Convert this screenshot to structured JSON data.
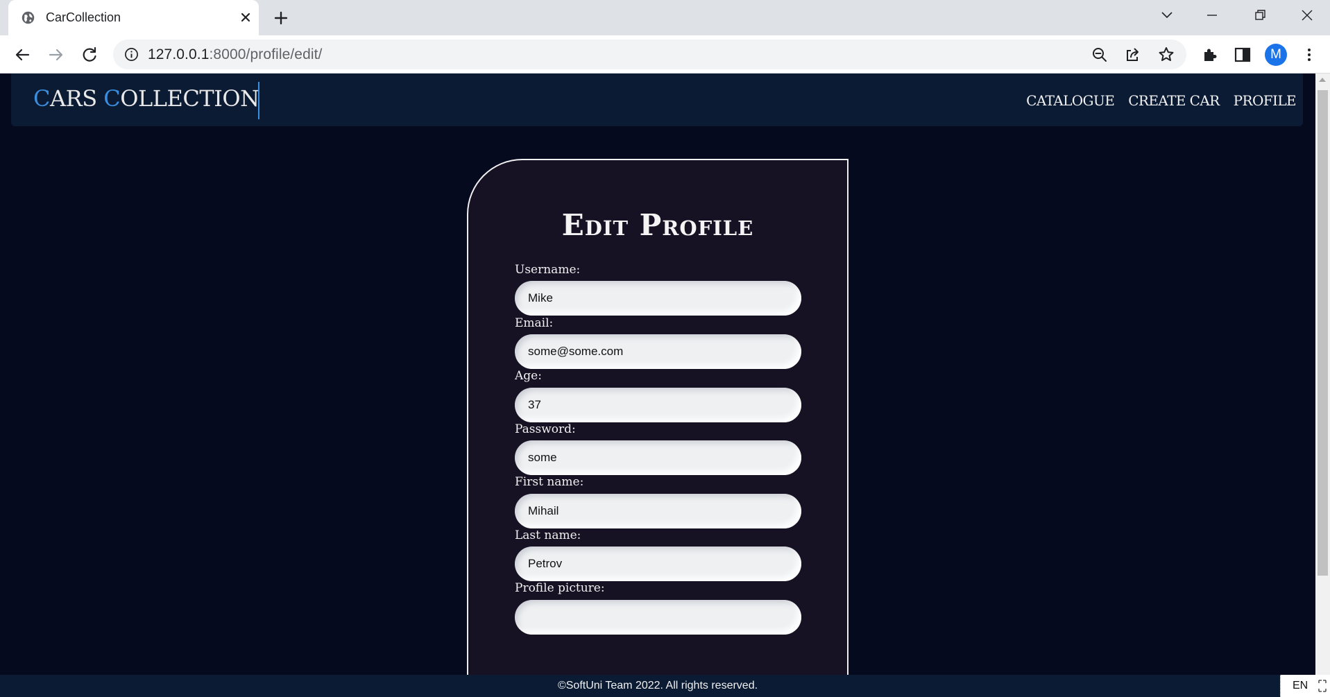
{
  "browser": {
    "tab_title": "CarCollection",
    "url_host": "127.0.0.1",
    "url_rest": ":8000/profile/edit/",
    "profile_initial": "M",
    "icons": [
      "globe-icon",
      "close-icon",
      "plus-icon",
      "chevron-down-icon",
      "minimize-icon",
      "restore-icon",
      "close-window-icon",
      "back-arrow-icon",
      "forward-arrow-icon",
      "reload-icon",
      "info-icon",
      "zoom-out-icon",
      "share-icon",
      "star-icon",
      "extensions-icon",
      "side-panel-icon",
      "more-vert-icon"
    ]
  },
  "site": {
    "logo_c1": "C",
    "logo_w1": "ARS ",
    "logo_c2": "C",
    "logo_w2": "OLLECTION",
    "nav": [
      "CATALOGUE",
      "CREATE CAR",
      "PROFILE"
    ],
    "accent_color": "#3a8fe0",
    "header_bg": "#0c1b34",
    "page_bg": "#050a1f",
    "card_bg": "#171124"
  },
  "form": {
    "title": "Edit Profile",
    "fields": [
      {
        "label": "Username:",
        "value": "Mike"
      },
      {
        "label": "Email:",
        "value": "some@some.com"
      },
      {
        "label": "Age:",
        "value": "37"
      },
      {
        "label": "Password:",
        "value": "some"
      },
      {
        "label": "First name:",
        "value": "Mihail"
      },
      {
        "label": "Last name:",
        "value": "Petrov"
      },
      {
        "label": "Profile picture:",
        "value": ""
      }
    ]
  },
  "footer": {
    "text": "©SoftUni Team 2022. All rights reserved.",
    "language": "EN"
  }
}
